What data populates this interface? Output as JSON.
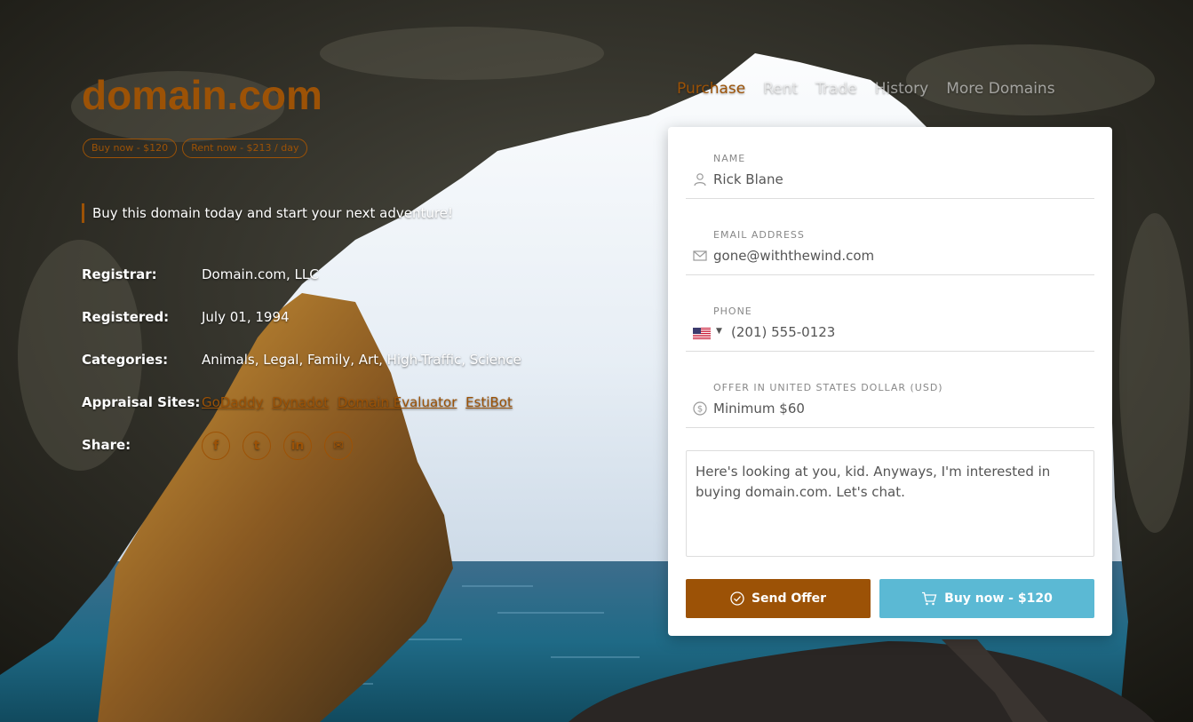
{
  "brand": {
    "title": "domain.com"
  },
  "badges": {
    "buy": "Buy now - $120",
    "rent": "Rent now - $213 / day"
  },
  "tagline": "Buy this domain today and start your next adventure!",
  "info": {
    "registrar_label": "Registrar:",
    "registrar_value": "Domain.com, LLC",
    "registered_label": "Registered:",
    "registered_value": "July 01, 1994",
    "categories_label": "Categories:",
    "categories_value": "Animals, Legal, Family, Art, High-Traffic, Science",
    "appraisal_label": "Appraisal Sites:",
    "appraisal_links": [
      "GoDaddy",
      "Dynadot",
      "Domain Evaluator",
      "EstiBot"
    ],
    "share_label": "Share:"
  },
  "share_icons": [
    "facebook-icon",
    "twitter-icon",
    "linkedin-icon",
    "email-icon"
  ],
  "nav": {
    "items": [
      "Purchase",
      "Rent",
      "Trade",
      "History",
      "More Domains"
    ],
    "active": "Purchase"
  },
  "form": {
    "name_label": "NAME",
    "name_value": "Rick Blane",
    "email_label": "EMAIL ADDRESS",
    "email_value": "gone@withthewind.com",
    "phone_label": "PHONE",
    "phone_value": "(201) 555-0123",
    "offer_label": "OFFER IN UNITED STATES DOLLAR (USD)",
    "offer_placeholder": "Minimum $60",
    "message": "Here's looking at you, kid. Anyways, I'm interested in buying domain.com. Let's chat.",
    "send_label": "Send Offer",
    "buy_label": "Buy now - $120"
  },
  "colors": {
    "accent": "#9c5206",
    "buy_button": "#5bb9d4"
  }
}
